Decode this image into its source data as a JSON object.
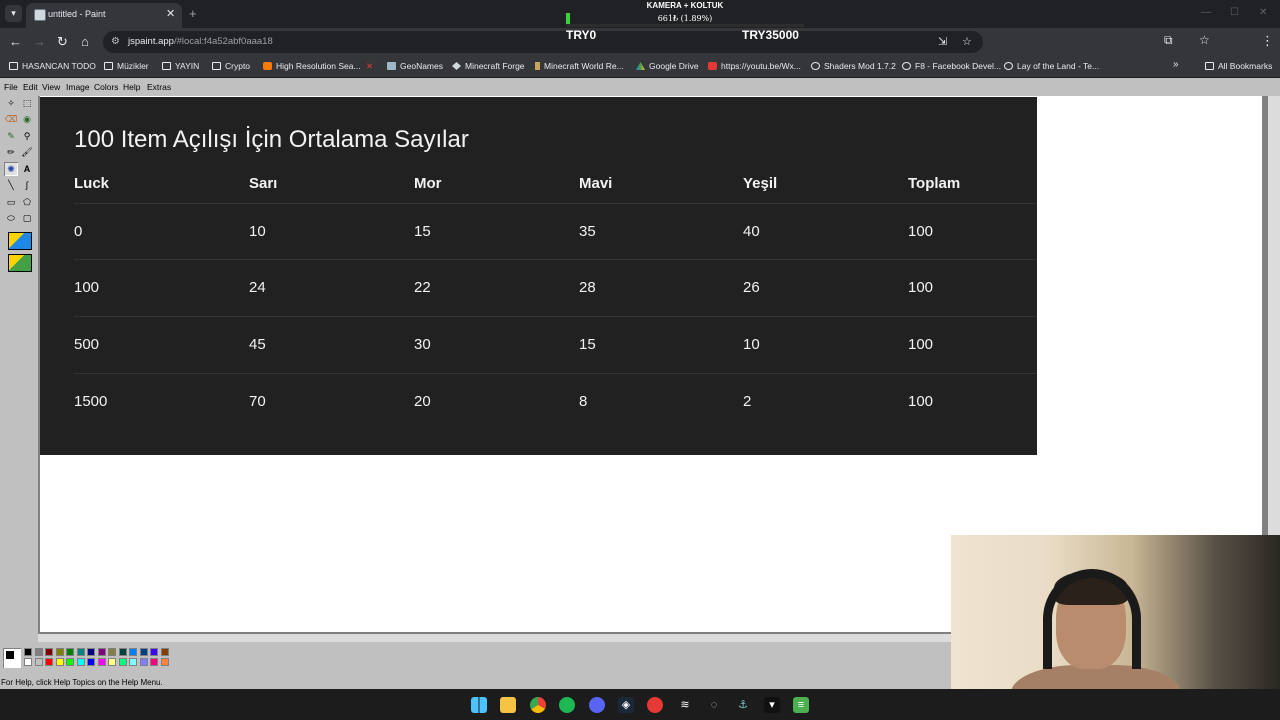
{
  "browser": {
    "tab_title": "untitled - Paint",
    "tab_close": "✕",
    "new_tab": "+",
    "url_host": "jspaint.app",
    "url_path": "/#local:f4a52abf0aaa18",
    "bookmarks": [
      {
        "label": "HASANCAN TODO",
        "icon": "folder-icon"
      },
      {
        "label": "Müzikler",
        "icon": "folder-icon"
      },
      {
        "label": "YAYIN",
        "icon": "folder-icon"
      },
      {
        "label": "Crypto",
        "icon": "folder-icon"
      },
      {
        "label": "High Resolution Sea...",
        "icon": "blogger-icon"
      },
      {
        "label": "",
        "icon": "x-logo-icon"
      },
      {
        "label": "GeoNames",
        "icon": "geonames-icon"
      },
      {
        "label": "Minecraft Forge",
        "icon": "forge-icon"
      },
      {
        "label": "Minecraft World Re...",
        "icon": "bottle-icon"
      },
      {
        "label": "Google Drive",
        "icon": "drive-icon"
      },
      {
        "label": "https://youtu.be/Wx...",
        "icon": "youtube-icon"
      },
      {
        "label": "Shaders Mod 1.7.2",
        "icon": "globe-icon"
      },
      {
        "label": "F8 - Facebook Devel...",
        "icon": "globe-icon"
      },
      {
        "label": "Lay of the Land - Te...",
        "icon": "globe-icon"
      }
    ],
    "all_bookmarks": "All Bookmarks",
    "more_bookmarks": "»"
  },
  "stream_overlay": {
    "title": "KAMERA + KOLTUK",
    "progress_text": "661₺ (1.89%)",
    "progress_fraction": 0.0189,
    "left_label": "TRY0",
    "right_label": "TRY35000"
  },
  "paint": {
    "menus": [
      "File",
      "Edit",
      "View",
      "Image",
      "Colors",
      "Help",
      "Extras"
    ],
    "status_text": "For Help, click Help Topics on the Help Menu.",
    "palette_colors": [
      "#000000",
      "#808080",
      "#800000",
      "#808000",
      "#008000",
      "#008080",
      "#000080",
      "#800080",
      "#808040",
      "#004040",
      "#0080ff",
      "#004080",
      "#4000ff",
      "#804000",
      "#ffffff",
      "#c0c0c0",
      "#ff0000",
      "#ffff00",
      "#00ff00",
      "#00ffff",
      "#0000ff",
      "#ff00ff",
      "#ffff80",
      "#00ff80",
      "#80ffff",
      "#8080ff",
      "#ff0080",
      "#ff8040"
    ]
  },
  "table": {
    "title": "100 Item Açılışı İçin Ortalama Sayılar",
    "headers": [
      "Luck",
      "Sarı",
      "Mor",
      "Mavi",
      "Yeşil",
      "Toplam"
    ],
    "rows": [
      [
        "0",
        "10",
        "15",
        "35",
        "40",
        "100"
      ],
      [
        "100",
        "24",
        "22",
        "28",
        "26",
        "100"
      ],
      [
        "500",
        "45",
        "30",
        "15",
        "10",
        "100"
      ],
      [
        "1500",
        "70",
        "20",
        "8",
        "2",
        "100"
      ]
    ]
  },
  "taskbar": {
    "apps": [
      "windows-start-icon",
      "file-explorer-icon",
      "chrome-icon",
      "spotify-icon",
      "discord-icon",
      "steam-icon",
      "app-red-icon",
      "app-zigzag-icon",
      "app-circle-icon",
      "app-hook-icon",
      "app-dark-icon",
      "notepad-icon"
    ]
  },
  "colors": {
    "table_bg": "#212121",
    "table_text": "#f2f2f2",
    "paint_bg": "#c0c0c0"
  }
}
